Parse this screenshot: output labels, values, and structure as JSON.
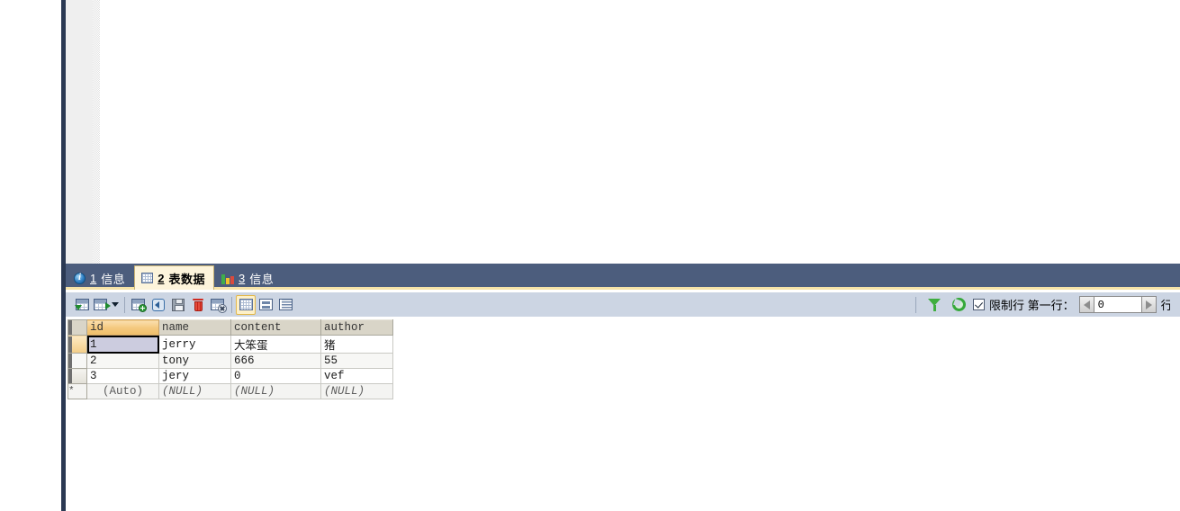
{
  "tabs": [
    {
      "num": "1",
      "label": "信息",
      "icon": "info-icon",
      "selected": false
    },
    {
      "num": "2",
      "label": "表数据",
      "icon": "grid-icon",
      "selected": true
    },
    {
      "num": "3",
      "label": "信息",
      "icon": "chart-icon",
      "selected": false
    }
  ],
  "toolbar": {
    "buttons": [
      {
        "name": "import-wizard-button",
        "icon": "table-import-icon"
      },
      {
        "name": "export-wizard-button",
        "icon": "table-export-icon"
      },
      {
        "name": "add-record-button",
        "icon": "table-add-icon"
      },
      {
        "name": "revert-record-button",
        "icon": "revert-icon"
      },
      {
        "name": "apply-changes-button",
        "icon": "save-icon"
      },
      {
        "name": "delete-record-button",
        "icon": "trash-icon"
      },
      {
        "name": "cancel-changes-button",
        "icon": "table-cancel-icon"
      },
      {
        "name": "grid-view-button",
        "icon": "grid-view-icon"
      },
      {
        "name": "form-view-button",
        "icon": "form-view-icon"
      },
      {
        "name": "text-view-button",
        "icon": "text-view-icon"
      }
    ],
    "right": {
      "filter_icon": "funnel-icon",
      "refresh_icon": "refresh-icon",
      "limit_checked": true,
      "limit_label": "限制行 第一行：",
      "offset_value": "0",
      "tail_label": "行"
    }
  },
  "grid": {
    "columns": [
      "id",
      "name",
      "content",
      "author"
    ],
    "sorted_column": "id",
    "rows": [
      {
        "id": "1",
        "name": "jerry",
        "content": "大笨蛋",
        "author": "猪"
      },
      {
        "id": "2",
        "name": "tony",
        "content": "666",
        "author": "55"
      },
      {
        "id": "3",
        "name": "jery",
        "content": "0",
        "author": "vef"
      }
    ],
    "new_row": {
      "id": "(Auto)",
      "name": "(NULL)",
      "content": "(NULL)",
      "author": "(NULL)"
    },
    "selected_cell": {
      "row": 0,
      "column": "id"
    }
  }
}
